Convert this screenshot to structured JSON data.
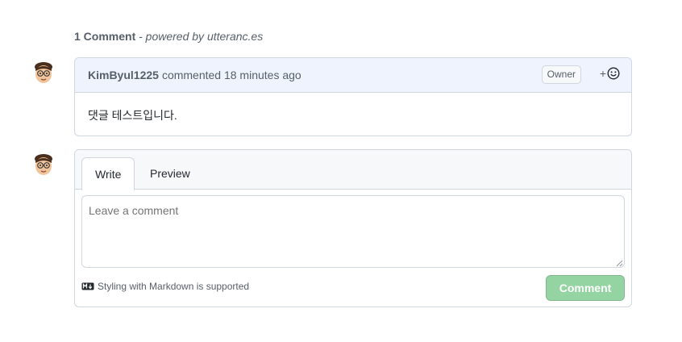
{
  "header": {
    "count": "1 Comment",
    "powered": " - powered by utteranc.es"
  },
  "comment": {
    "author": "KimByul1225",
    "meta": "commented 18 minutes ago",
    "badge": "Owner",
    "reaction_plus": "+",
    "body": "댓글 테스트입니다."
  },
  "editor": {
    "tabs": [
      "Write",
      "Preview"
    ],
    "placeholder": "Leave a comment",
    "markdown_note": "Styling with Markdown is supported",
    "submit_label": "Comment"
  },
  "colors": {
    "submit_disabled": "#94d3a2",
    "comment_header_bg": "#eef3fd"
  },
  "icons": {
    "avatar": "memoji-avatar-icon",
    "reaction": "smiley-icon",
    "markdown": "markdown-icon"
  }
}
